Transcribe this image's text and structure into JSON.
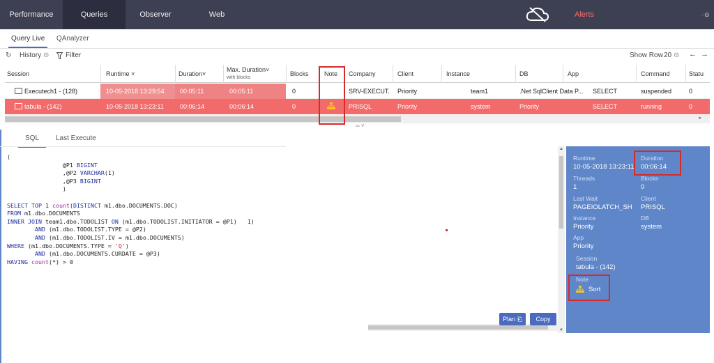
{
  "nav": {
    "tabs": [
      "Performance",
      "Queries",
      "Observer",
      "Web"
    ],
    "active_tab": "Queries",
    "alerts": "Alerts",
    "menu_glyph": "··⊝"
  },
  "subtabs": [
    "Query Live",
    "QAnalyzer"
  ],
  "toolbar": {
    "refresh_glyph": "↻",
    "history": "History",
    "history_glyph": "⊝",
    "filter": "Filter",
    "show_row_label": "Show Row",
    "show_row_value": "20",
    "show_row_glyph": "⊝",
    "prev": "←",
    "next": "→"
  },
  "grid": {
    "headers": {
      "session": "Session",
      "runtime": "Runtime ˅",
      "duration": "Duration˅",
      "max_duration": "Max. Duration˅",
      "max_duration_sub": "with blocks",
      "blocks": "Blocks",
      "note": "Note",
      "company": "Company",
      "client": "Client",
      "instance": "Instance",
      "db": "DB",
      "app": "App",
      "command": "Command",
      "status": "Statu"
    },
    "rows": [
      {
        "session": "Executech1 - (128)",
        "runtime": "10-05-2018 13:29:54",
        "duration": "00:05:11",
        "max_duration": "00:05:11",
        "blocks": "0",
        "note": "",
        "company": "SRV-EXECUT...",
        "client": "Priority",
        "instance": "team1",
        "db": ".Net SqlClient Data P...",
        "app": "SELECT",
        "command": "suspended",
        "status": "0"
      },
      {
        "session": "tabula - (142)",
        "runtime": "10-05-2018 13:23:11",
        "duration": "00:06:14",
        "max_duration": "00:06:14",
        "blocks": "0",
        "note": "sort-icon",
        "company": "PRISQL",
        "client": "Priority",
        "instance": "system",
        "db": "Priority",
        "app": "SELECT",
        "command": "running",
        "status": "0"
      }
    ],
    "splitter": "═ ˅"
  },
  "bottom_tabs": [
    "SQL",
    "Last Execute"
  ],
  "sql": {
    "lines": [
      "(",
      "                @P1 BIGINT",
      "                ,@P2 VARCHAR(1)",
      "                ,@P3 BIGINT",
      "                )",
      "",
      "SELECT TOP 1 count(DISTINCT m1.dbo.DOCUMENTS.DOC)",
      "FROM m1.dbo.DOCUMENTS",
      "INNER JOIN team1.dbo.TODOLIST ON (m1.dbo.TODOLIST.INITIATOR = @P1)   1)",
      "        AND (m1.dbo.TODOLIST.TYPE = @P2)",
      "        AND (m1.dbo.TODOLIST.IV = m1.dbo.DOCUMENTS)",
      "WHERE (m1.dbo.DOCUMENTS.TYPE = 'Q')",
      "        AND (m1.dbo.DOCUMENTS.CURDATE = @P3)",
      "HAVING count(*) > 0"
    ]
  },
  "buttons": {
    "plan": "Plan ⎗",
    "copy": "Copy"
  },
  "details": {
    "runtime_label": "Runtime",
    "runtime": "10-05-2018 13:23:11",
    "duration_label": "Duration",
    "duration": "00:06:14",
    "threads_label": "Threads",
    "threads": "1",
    "blocks_label": "Blocks",
    "blocks": "0",
    "lastwait_label": "Last Wait",
    "lastwait": "PAGEIOLATCH_SH",
    "client_label": "Client",
    "client": "PRISQL",
    "instance_label": "Instance",
    "instance": "Priority",
    "db_label": "DB",
    "db": "system",
    "app_label": "App",
    "app": "Priority",
    "session_label": "Session",
    "session": "tabula - (142)",
    "note_label": "Note",
    "note": "Sort"
  },
  "colors": {
    "nav_bg": "#3d3f52",
    "accent": "#4b6bbf",
    "row_highlight": "#f26a6a",
    "details_bg": "#5e86c8",
    "annotation_red": "#d62b2b",
    "sort_icon": "#f5c518"
  }
}
